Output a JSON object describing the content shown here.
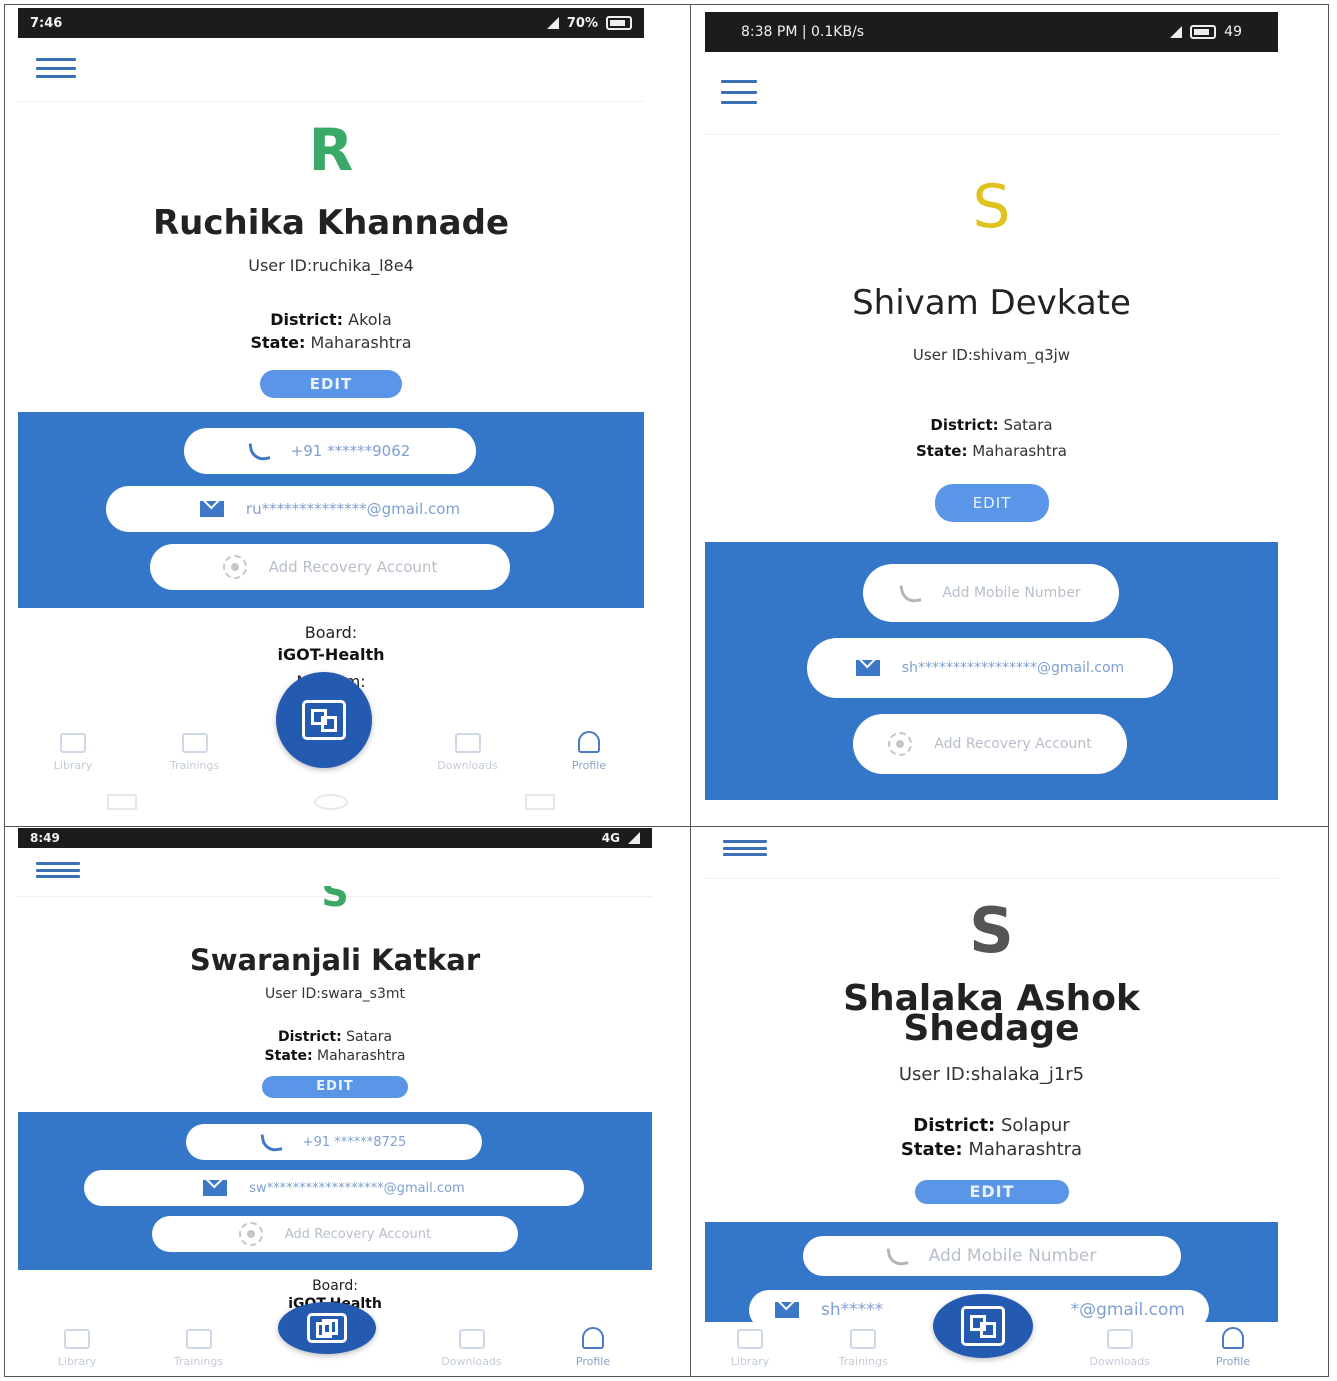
{
  "panels": [
    {
      "status_time": "7:46",
      "status_battery": "70%",
      "initial": "R",
      "initial_color": "#3aa866",
      "name": "Ruchika Khannade",
      "user_id": "User ID:ruchika_l8e4",
      "district_label": "District:",
      "district": "Akola",
      "state_label": "State:",
      "state": "Maharashtra",
      "edit_label": "EDIT",
      "phone": "+91 ******9062",
      "email": "ru**************@gmail.com",
      "recovery": "Add Recovery Account",
      "board_label": "Board:",
      "board": "iGOT-Health",
      "medium_label": "Medium:",
      "nav": [
        "Library",
        "Trainings",
        "Downloads",
        "Profile"
      ]
    },
    {
      "status_time": "8:38 PM | 0.1KB/s",
      "status_battery": "49",
      "initial": "S",
      "initial_color": "#e0c21e",
      "name": "Shivam Devkate",
      "user_id": "User ID:shivam_q3jw",
      "district_label": "District:",
      "district": "Satara",
      "state_label": "State:",
      "state": "Maharashtra",
      "edit_label": "EDIT",
      "phone_placeholder": "Add Mobile Number",
      "email": "sh*****************@gmail.com",
      "recovery": "Add Recovery Account"
    },
    {
      "status_time": "8:49",
      "status_network": "4G",
      "initial": "S",
      "initial_color": "#3aa866",
      "name": "Swaranjali Katkar",
      "user_id": "User ID:swara_s3mt",
      "district_label": "District:",
      "district": "Satara",
      "state_label": "State:",
      "state": "Maharashtra",
      "edit_label": "EDIT",
      "phone": "+91 ******8725",
      "email": "sw******************@gmail.com",
      "recovery": "Add Recovery Account",
      "board_label": "Board:",
      "board": "iGOT-Health",
      "nav": [
        "Library",
        "Trainings",
        "Downloads",
        "Profile"
      ]
    },
    {
      "initial": "S",
      "initial_color": "#555555",
      "name_line1": "Shalaka Ashok",
      "name_line2": "Shedage",
      "user_id": "User ID:shalaka_j1r5",
      "district_label": "District:",
      "district": "Solapur",
      "state_label": "State:",
      "state": "Maharashtra",
      "edit_label": "EDIT",
      "phone_placeholder": "Add Mobile Number",
      "email_start": "sh*****",
      "email_end": "*@gmail.com",
      "nav": [
        "Library",
        "Trainings",
        "Downloads",
        "Profile"
      ]
    }
  ],
  "colors": {
    "profile_band": "#3477c9",
    "edit_button": "#5b95e8",
    "scan_button": "#245bb0"
  },
  "icons": [
    "menu-icon",
    "phone-icon",
    "mail-icon",
    "recovery-icon",
    "qr-scan-icon",
    "library-icon",
    "trainings-icon",
    "downloads-icon",
    "profile-icon"
  ]
}
